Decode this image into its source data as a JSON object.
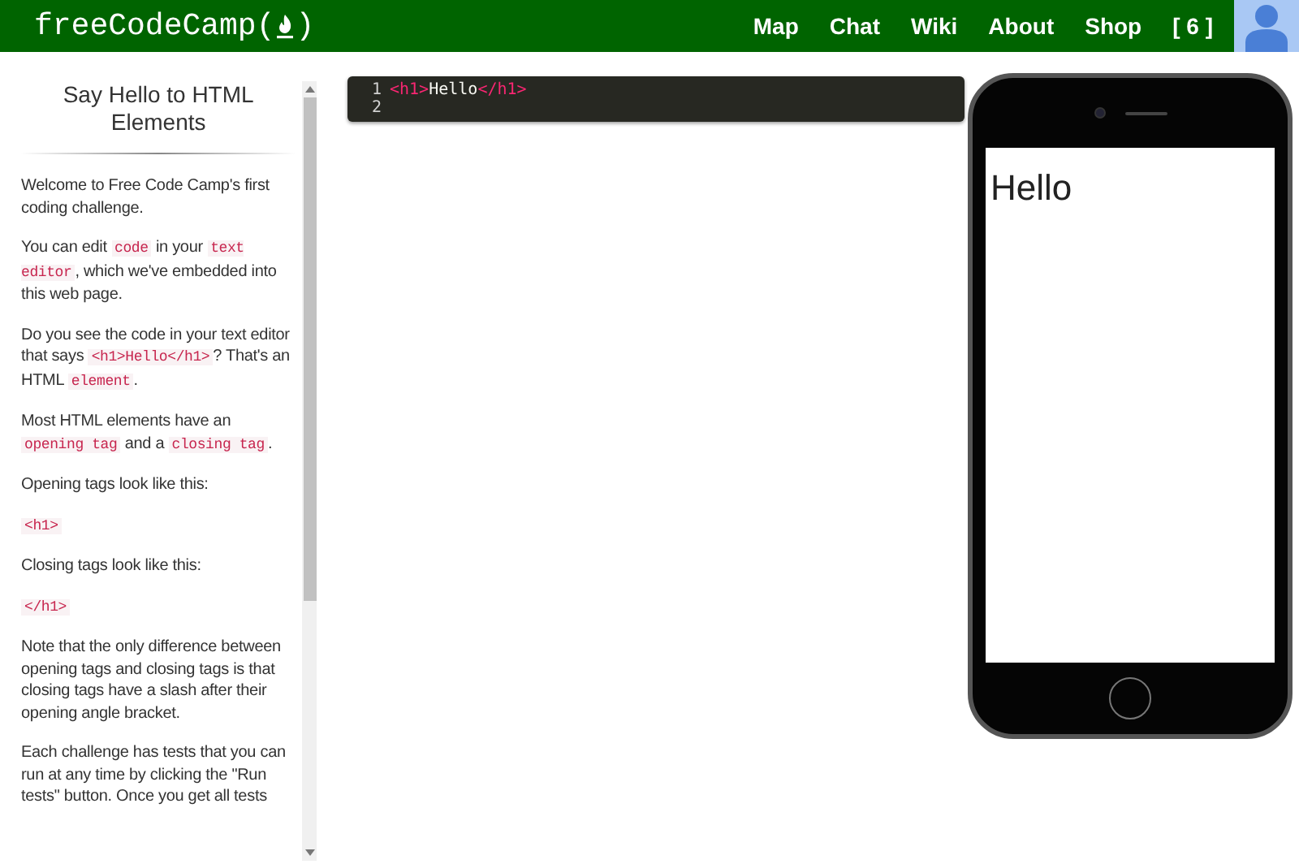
{
  "navbar": {
    "logo": {
      "text_before": "freeCodeCamp(",
      "text_after": ")"
    },
    "links": [
      {
        "label": "Map"
      },
      {
        "label": "Chat"
      },
      {
        "label": "Wiki"
      },
      {
        "label": "About"
      },
      {
        "label": "Shop"
      },
      {
        "label": "[ 6 ]"
      }
    ]
  },
  "challenge": {
    "title": "Say Hello to HTML Elements",
    "paragraphs": [
      [
        {
          "kind": "text",
          "text": "Welcome to Free Code Camp's first coding challenge."
        }
      ],
      [
        {
          "kind": "text",
          "text": "You can edit "
        },
        {
          "kind": "code",
          "text": "code"
        },
        {
          "kind": "text",
          "text": " in your "
        },
        {
          "kind": "code",
          "text": "text editor"
        },
        {
          "kind": "text",
          "text": ", which we've embedded into this web page."
        }
      ],
      [
        {
          "kind": "text",
          "text": "Do you see the code in your text editor that says "
        },
        {
          "kind": "code",
          "text": "<h1>Hello</h1>"
        },
        {
          "kind": "text",
          "text": "? That's an HTML "
        },
        {
          "kind": "code",
          "text": "element"
        },
        {
          "kind": "text",
          "text": "."
        }
      ],
      [
        {
          "kind": "text",
          "text": "Most HTML elements have an "
        },
        {
          "kind": "code",
          "text": "opening tag"
        },
        {
          "kind": "text",
          "text": " and a "
        },
        {
          "kind": "code",
          "text": "closing tag"
        },
        {
          "kind": "text",
          "text": "."
        }
      ],
      [
        {
          "kind": "text",
          "text": "Opening tags look like this:"
        }
      ],
      [
        {
          "kind": "code",
          "text": "<h1>"
        }
      ],
      [
        {
          "kind": "text",
          "text": "Closing tags look like this:"
        }
      ],
      [
        {
          "kind": "code",
          "text": "</h1>"
        }
      ],
      [
        {
          "kind": "text",
          "text": "Note that the only difference between opening tags and closing tags is that closing tags have a slash after their opening angle bracket."
        }
      ],
      [
        {
          "kind": "text",
          "text": "Each challenge has tests that you can run at any time by clicking the \"Run tests\" button. Once you get all tests"
        }
      ]
    ]
  },
  "editor": {
    "lines": [
      {
        "number": "1",
        "parts": [
          {
            "kind": "tag",
            "text": "<h1>"
          },
          {
            "kind": "text",
            "text": "Hello"
          },
          {
            "kind": "tag",
            "text": "</h1>"
          }
        ]
      },
      {
        "number": "2"
      }
    ]
  },
  "preview": {
    "heading": "Hello"
  }
}
